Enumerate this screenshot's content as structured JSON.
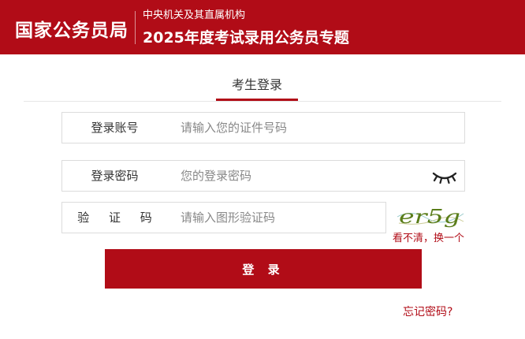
{
  "header": {
    "brand": "国家公务员局",
    "subtitle": "中央机关及其直属机构",
    "title": "2025年度考试录用公务员专题"
  },
  "tabs": [
    {
      "label": "考生登录",
      "active": true
    }
  ],
  "form": {
    "account": {
      "label": "登录账号",
      "placeholder": "请输入您的证件号码",
      "value": ""
    },
    "password": {
      "label": "登录密码",
      "placeholder": "您的登录密码",
      "value": ""
    },
    "captcha": {
      "label": "验 证 码",
      "placeholder": "请输入图形验证码",
      "value": "",
      "refresh_text": "看不清，换一个",
      "image_text": "er5g"
    },
    "submit_label": "登 录",
    "forgot_label": "忘记密码?"
  },
  "colors": {
    "brand": "#b10c17",
    "border": "#dcdcdc"
  },
  "icons": {
    "password_toggle": "eye-closed-icon"
  }
}
